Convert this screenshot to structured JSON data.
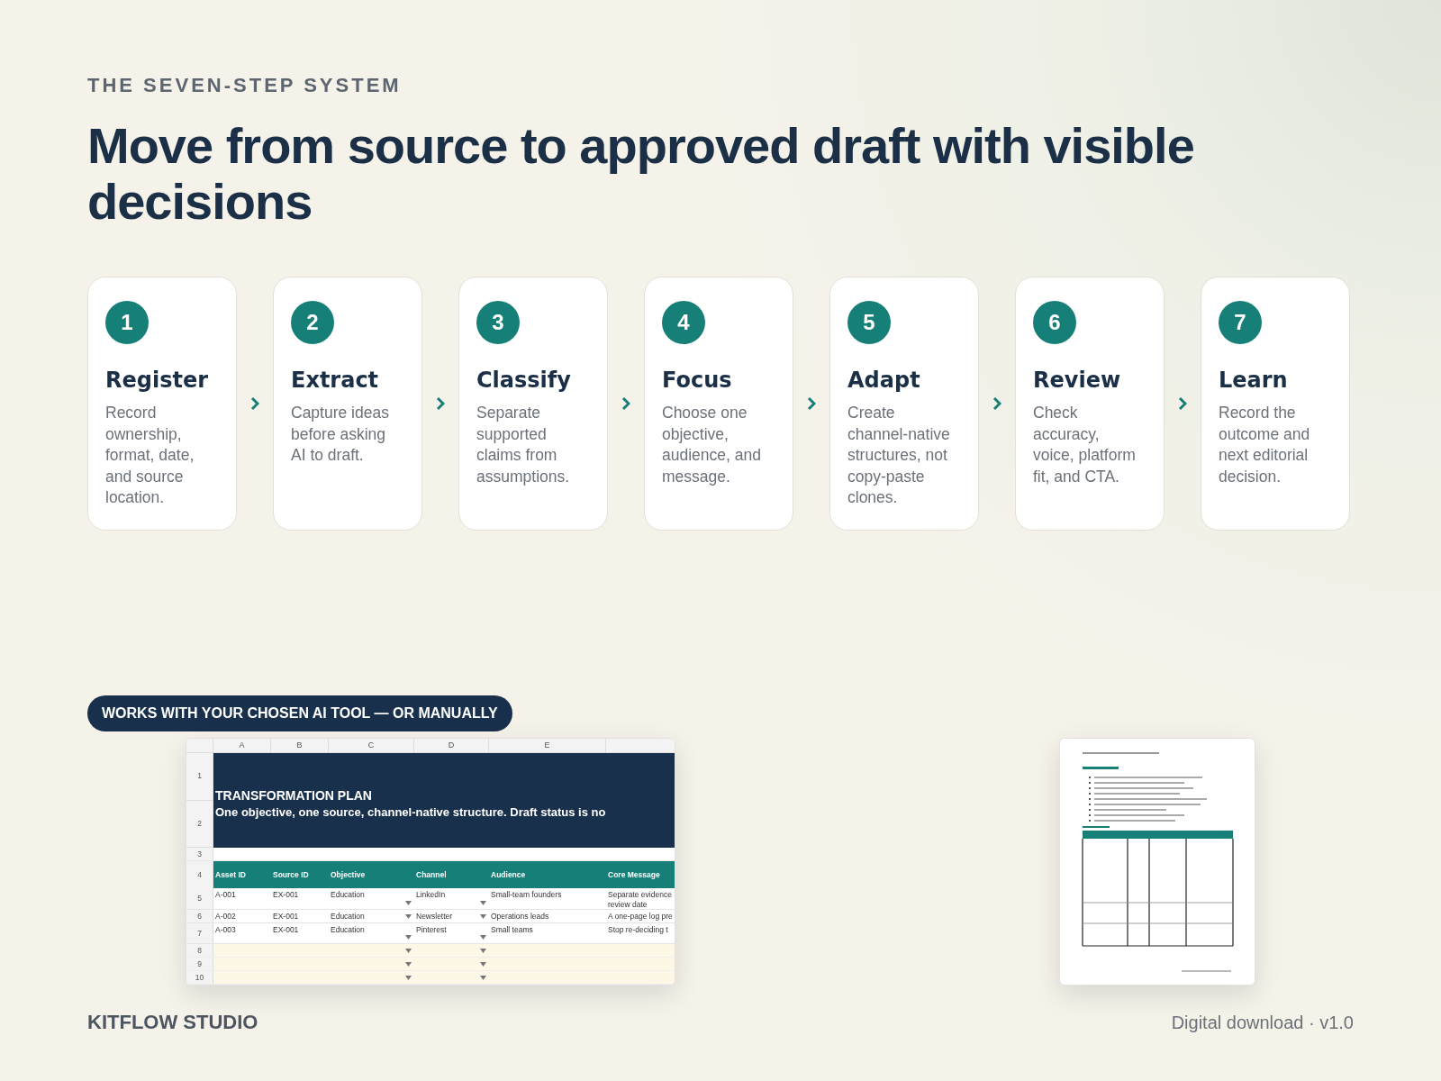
{
  "eyebrow": "THE SEVEN-STEP SYSTEM",
  "heading": "Move from source to approved draft with visible decisions",
  "steps": [
    {
      "number": "1",
      "title": "Register",
      "description": "Record ownership, format, date, and source location."
    },
    {
      "number": "2",
      "title": "Extract",
      "description": "Capture ideas before asking AI to draft."
    },
    {
      "number": "3",
      "title": "Classify",
      "description": "Separate supported claims from assumptions."
    },
    {
      "number": "4",
      "title": "Focus",
      "description": "Choose one objective, audience, and message."
    },
    {
      "number": "5",
      "title": "Adapt",
      "description": "Create channel-native structures, not copy-paste clones."
    },
    {
      "number": "6",
      "title": "Review",
      "description": "Check accuracy, voice, platform fit, and CTA."
    },
    {
      "number": "7",
      "title": "Learn",
      "description": "Record the outcome and next editorial decision."
    }
  ],
  "badge": "WORKS WITH YOUR CHOSEN AI TOOL — OR MANUALLY",
  "spreadsheet": {
    "column_letters": [
      "A",
      "B",
      "C",
      "D",
      "E"
    ],
    "banner_rows": [
      "1",
      "2"
    ],
    "title": "TRANSFORMATION PLAN",
    "subtitle": "One objective, one source, channel-native structure. Draft status is no",
    "spacer_row": "3",
    "header_row": "4",
    "columns": [
      {
        "label": "Asset ID",
        "kind": "text"
      },
      {
        "label": "Source ID",
        "kind": "text"
      },
      {
        "label": "Objective",
        "kind": "dropdown"
      },
      {
        "label": "Channel",
        "kind": "dropdown"
      },
      {
        "label": "Audience",
        "kind": "text"
      },
      {
        "label": "Core Message",
        "kind": "text"
      }
    ],
    "rows": [
      {
        "row_number": "5",
        "cells": [
          "A-001",
          "EX-001",
          "Education",
          "LinkedIn",
          "Small-team founders",
          "Separate evidence review date"
        ]
      },
      {
        "row_number": "6",
        "cells": [
          "A-002",
          "EX-001",
          "Education",
          "Newsletter",
          "Operations leads",
          "A one-page log pre"
        ]
      },
      {
        "row_number": "7",
        "cells": [
          "A-003",
          "EX-001",
          "Education",
          "Pinterest",
          "Small teams",
          "Stop re-deciding t"
        ]
      }
    ],
    "empty_rows": [
      "8",
      "9",
      "10"
    ]
  },
  "footer": {
    "brand": "KITFLOW STUDIO",
    "version": "Digital download · v1.0"
  }
}
